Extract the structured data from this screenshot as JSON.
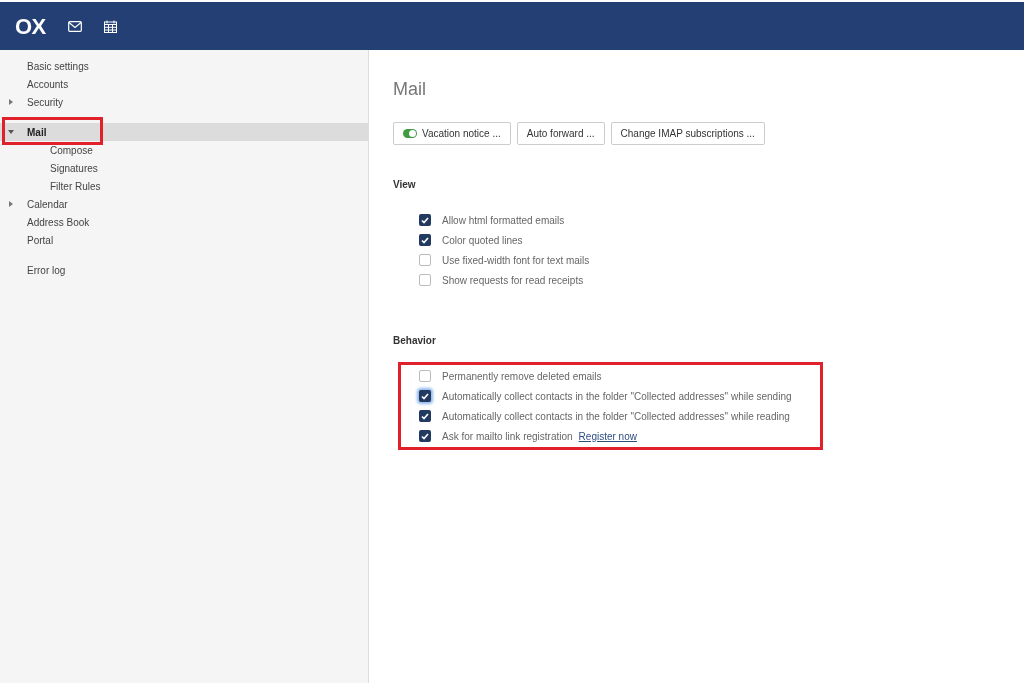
{
  "header": {
    "logo": "OX"
  },
  "sidebar": {
    "groups": [
      {
        "items": [
          {
            "label": "Basic settings",
            "selected": false
          },
          {
            "label": "Accounts",
            "selected": false
          },
          {
            "label": "Security",
            "selected": false,
            "expanded": false
          }
        ]
      },
      {
        "items": [
          {
            "label": "Mail",
            "selected": true,
            "expanded": true,
            "annotated": true,
            "children": [
              {
                "label": "Compose",
                "selected": false
              },
              {
                "label": "Signatures",
                "selected": false
              },
              {
                "label": "Filter Rules",
                "selected": false
              }
            ]
          },
          {
            "label": "Calendar",
            "selected": false,
            "expanded": false
          },
          {
            "label": "Address Book",
            "selected": false
          },
          {
            "label": "Portal",
            "selected": false
          }
        ]
      },
      {
        "items": [
          {
            "label": "Error log",
            "selected": false
          }
        ]
      }
    ]
  },
  "main": {
    "title": "Mail",
    "buttons": [
      {
        "label": "Vacation notice ...",
        "toggle_on": true
      },
      {
        "label": "Auto forward ..."
      },
      {
        "label": "Change IMAP subscriptions ..."
      }
    ],
    "sections": [
      {
        "heading": "View",
        "options": [
          {
            "label": "Allow html formatted emails",
            "checked": true
          },
          {
            "label": "Color quoted lines",
            "checked": true
          },
          {
            "label": "Use fixed-width font for text mails",
            "checked": false
          },
          {
            "label": "Show requests for read receipts",
            "checked": false
          }
        ]
      },
      {
        "heading": "Behavior",
        "annotated": true,
        "options": [
          {
            "label": "Permanently remove deleted emails",
            "checked": false
          },
          {
            "label": "Automatically collect contacts in the folder \"Collected addresses\" while sending",
            "checked": true,
            "focused": true
          },
          {
            "label": "Automatically collect contacts in the folder \"Collected addresses\" while reading",
            "checked": true
          },
          {
            "label": "Ask for mailto link registration",
            "checked": true,
            "link": "Register now"
          }
        ]
      }
    ]
  }
}
